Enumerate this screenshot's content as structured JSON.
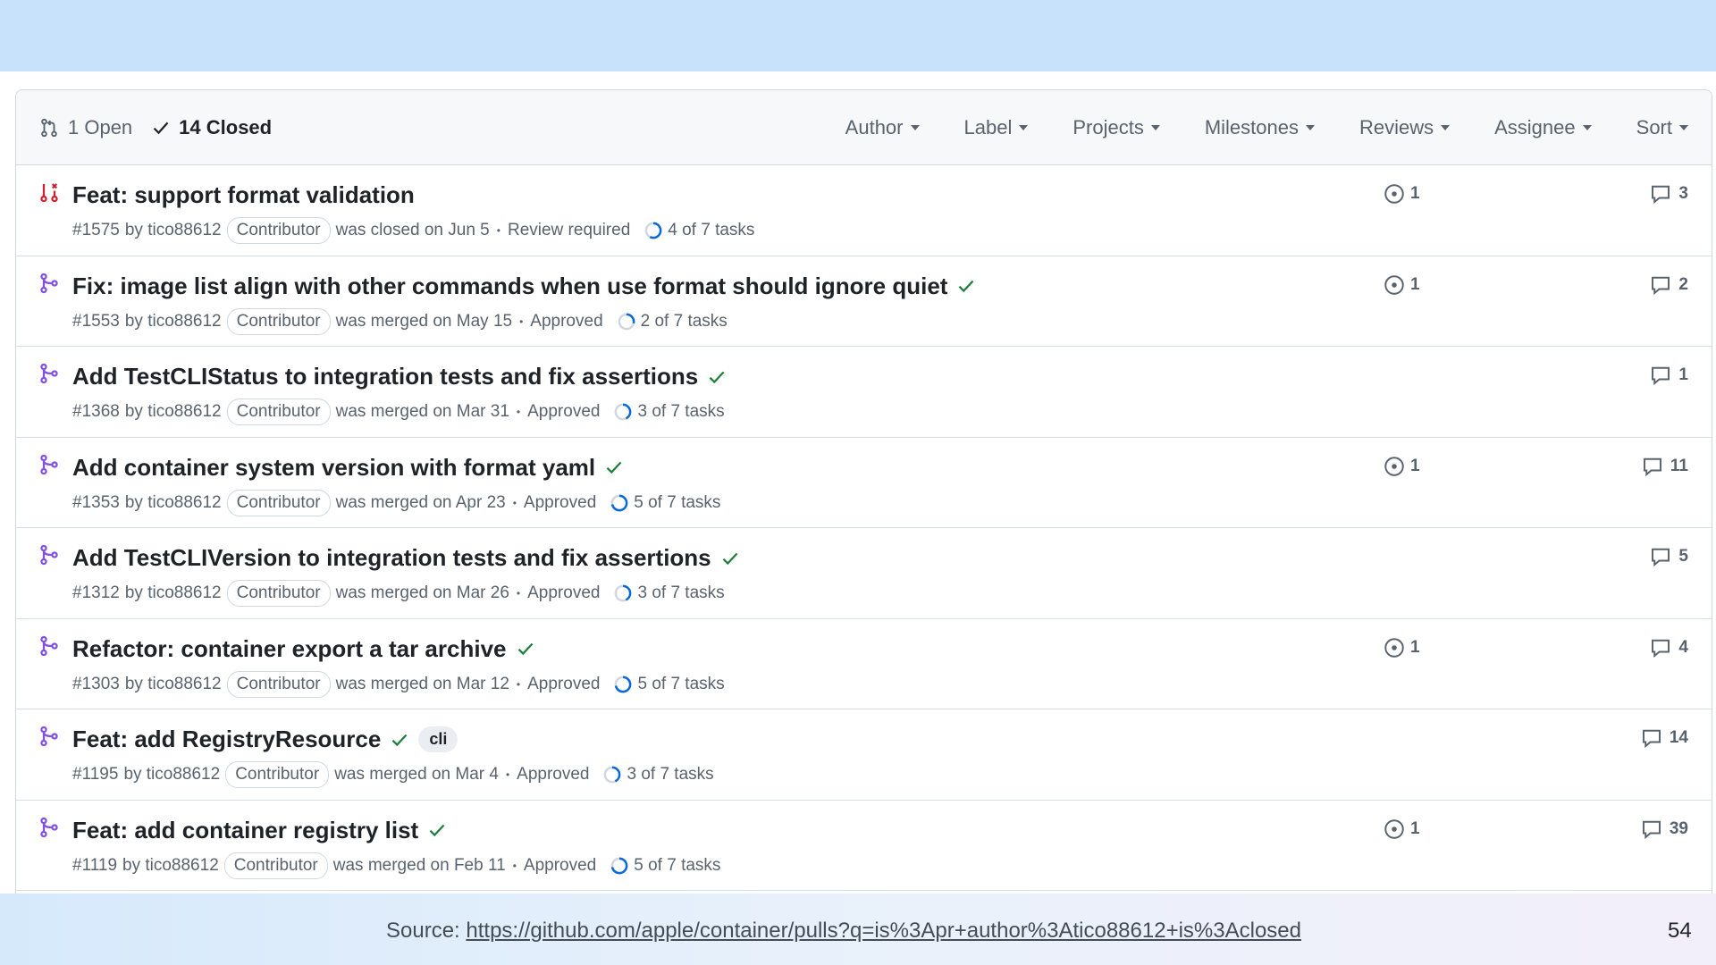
{
  "header": {
    "open_label": "1 Open",
    "closed_label": "14 Closed",
    "filters": [
      "Author",
      "Label",
      "Projects",
      "Milestones",
      "Reviews",
      "Assignee",
      "Sort"
    ]
  },
  "pull_requests": [
    {
      "title": "Feat: support format validation",
      "state": "closed",
      "number": "#1575",
      "by": "by tico88612",
      "badge": "Contributor",
      "status_text": "was closed on Jun 5",
      "review": "Review required",
      "tasks": "4 of 7 tasks",
      "tasks_done": 4,
      "linked_issues": "1",
      "comments": "3",
      "check": false,
      "label": ""
    },
    {
      "title": "Fix: image list align with other commands when use format should ignore quiet",
      "state": "merged",
      "number": "#1553",
      "by": "by tico88612",
      "badge": "Contributor",
      "status_text": "was merged on May 15",
      "review": "Approved",
      "tasks": "2 of 7 tasks",
      "tasks_done": 2,
      "linked_issues": "1",
      "comments": "2",
      "check": true,
      "label": ""
    },
    {
      "title": "Add TestCLIStatus to integration tests and fix assertions",
      "state": "merged",
      "number": "#1368",
      "by": "by tico88612",
      "badge": "Contributor",
      "status_text": "was merged on Mar 31",
      "review": "Approved",
      "tasks": "3 of 7 tasks",
      "tasks_done": 3,
      "linked_issues": "",
      "comments": "1",
      "check": true,
      "label": ""
    },
    {
      "title": "Add container system version with format yaml",
      "state": "merged",
      "number": "#1353",
      "by": "by tico88612",
      "badge": "Contributor",
      "status_text": "was merged on Apr 23",
      "review": "Approved",
      "tasks": "5 of 7 tasks",
      "tasks_done": 5,
      "linked_issues": "1",
      "comments": "11",
      "check": true,
      "label": ""
    },
    {
      "title": "Add TestCLIVersion to integration tests and fix assertions",
      "state": "merged",
      "number": "#1312",
      "by": "by tico88612",
      "badge": "Contributor",
      "status_text": "was merged on Mar 26",
      "review": "Approved",
      "tasks": "3 of 7 tasks",
      "tasks_done": 3,
      "linked_issues": "",
      "comments": "5",
      "check": true,
      "label": ""
    },
    {
      "title": "Refactor: container export a tar archive",
      "state": "merged",
      "number": "#1303",
      "by": "by tico88612",
      "badge": "Contributor",
      "status_text": "was merged on Mar 12",
      "review": "Approved",
      "tasks": "5 of 7 tasks",
      "tasks_done": 5,
      "linked_issues": "1",
      "comments": "4",
      "check": true,
      "label": ""
    },
    {
      "title": "Feat: add RegistryResource",
      "state": "merged",
      "number": "#1195",
      "by": "by tico88612",
      "badge": "Contributor",
      "status_text": "was merged on Mar 4",
      "review": "Approved",
      "tasks": "3 of 7 tasks",
      "tasks_done": 3,
      "linked_issues": "",
      "comments": "14",
      "check": true,
      "label": "cli"
    },
    {
      "title": "Feat: add container registry list",
      "state": "merged",
      "number": "#1119",
      "by": "by tico88612",
      "badge": "Contributor",
      "status_text": "was merged on Feb 11",
      "review": "Approved",
      "tasks": "5 of 7 tasks",
      "tasks_done": 5,
      "linked_issues": "1",
      "comments": "39",
      "check": true,
      "label": ""
    }
  ],
  "footer": {
    "source_prefix": "Source: ",
    "source_url": "https://github.com/apple/container/pulls?q=is%3Apr+author%3Atico88612+is%3Aclosed",
    "page_number": "54"
  },
  "colors": {
    "merged": "#8250df",
    "closed": "#cf222e",
    "check": "#1a7f37",
    "progress": "#0969da"
  }
}
